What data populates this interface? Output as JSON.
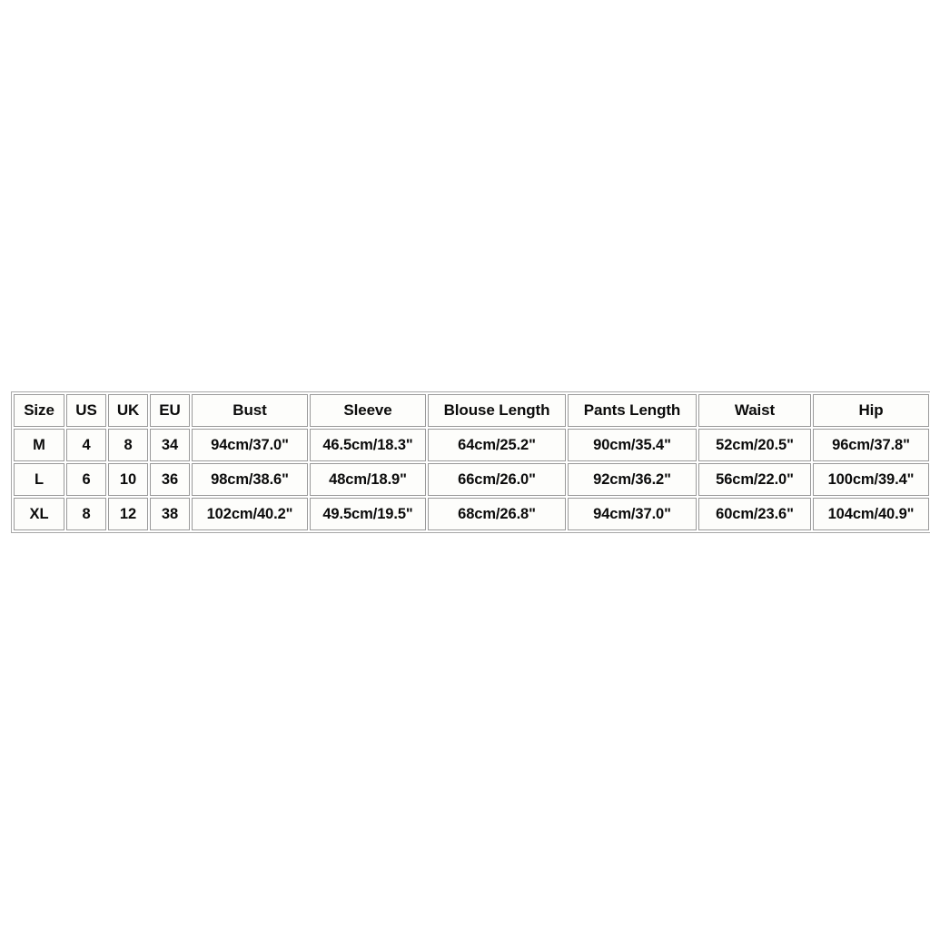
{
  "table": {
    "columns": [
      "Size",
      "US",
      "UK",
      "EU",
      "Bust",
      "Sleeve",
      "Blouse Length",
      "Pants Length",
      "Waist",
      "Hip"
    ],
    "rows": [
      {
        "size": "M",
        "us": "4",
        "uk": "8",
        "eu": "34",
        "bust": "94cm/37.0\"",
        "sleeve": "46.5cm/18.3\"",
        "blouse_length": "64cm/25.2\"",
        "pants_length": "90cm/35.4\"",
        "waist": "52cm/20.5\"",
        "hip": "96cm/37.8\""
      },
      {
        "size": "L",
        "us": "6",
        "uk": "10",
        "eu": "36",
        "bust": "98cm/38.6\"",
        "sleeve": "48cm/18.9\"",
        "blouse_length": "66cm/26.0\"",
        "pants_length": "92cm/36.2\"",
        "waist": "56cm/22.0\"",
        "hip": "100cm/39.4\""
      },
      {
        "size": "XL",
        "us": "8",
        "uk": "12",
        "eu": "38",
        "bust": "102cm/40.2\"",
        "sleeve": "49.5cm/19.5\"",
        "blouse_length": "68cm/26.8\"",
        "pants_length": "94cm/37.0\"",
        "waist": "60cm/23.6\"",
        "hip": "104cm/40.9\""
      }
    ]
  },
  "colors": {
    "page_background": "#ffffff",
    "cell_background": "#fdfdfb",
    "cell_border": "#9a9a9a",
    "table_border": "#a8a8a8",
    "text": "#0b0b0b"
  }
}
